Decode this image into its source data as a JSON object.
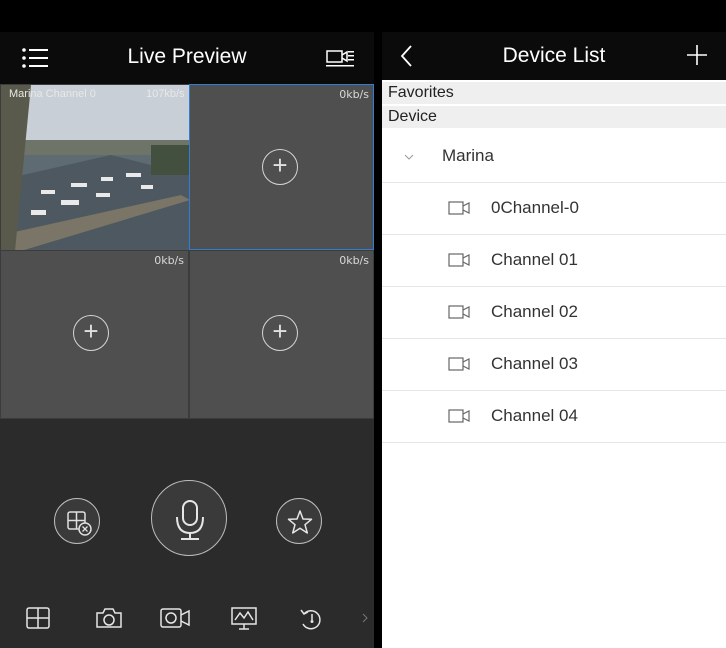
{
  "live_preview": {
    "title": "Live Preview",
    "cells": [
      {
        "label": "Marina Channel 0",
        "rate": "107kb/s",
        "has_video": true
      },
      {
        "rate": "0kb/s"
      },
      {
        "rate": "0kb/s"
      },
      {
        "rate": "0kb/s"
      }
    ]
  },
  "device_list": {
    "title": "Device List",
    "sections": {
      "favorites": "Favorites",
      "device": "Device"
    },
    "group": "Marina",
    "channels": [
      "0Channel-0",
      "Channel 01",
      "Channel 02",
      "Channel 03",
      "Channel 04"
    ]
  },
  "colors": {
    "accent": "#2d7fd6",
    "header_bg": "#0b0b0b",
    "pane_bg": "#2f2f2f"
  }
}
